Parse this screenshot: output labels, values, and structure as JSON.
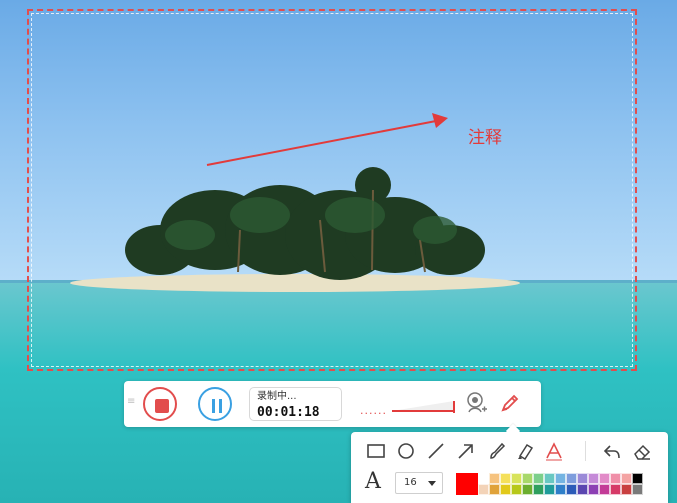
{
  "overlay": {
    "annotation_text": "注释"
  },
  "toolbar": {
    "drag_handle": "≡",
    "status_text": "录制中...",
    "timer": "00:01:18",
    "volume_dots": "......",
    "colors": {
      "stop": "#e24d4d",
      "pause": "#3aa0e2"
    }
  },
  "drawing_panel": {
    "tools": [
      {
        "name": "rectangle-tool",
        "icon": "rectangle-icon"
      },
      {
        "name": "ellipse-tool",
        "icon": "circle-icon"
      },
      {
        "name": "line-tool",
        "icon": "line-icon"
      },
      {
        "name": "arrow-tool",
        "icon": "arrow-icon"
      },
      {
        "name": "brush-tool",
        "icon": "brush-icon"
      },
      {
        "name": "highlighter-tool",
        "icon": "highlighter-icon"
      },
      {
        "name": "text-tool",
        "icon": "text-a-icon"
      },
      {
        "name": "undo-tool",
        "icon": "undo-icon"
      },
      {
        "name": "eraser-tool",
        "icon": "eraser-icon"
      }
    ],
    "font_glyph": "A",
    "font_size": "16",
    "current_color": "#ff0000",
    "palette_row1": [
      "#ffffff",
      "#f6c37f",
      "#f5e05a",
      "#d8e35a",
      "#a8d86a",
      "#7ccf8b",
      "#69c8c2",
      "#74b4e2",
      "#7e9ddd",
      "#9b8ad8",
      "#c58ad8",
      "#e28bc8",
      "#f08fa8",
      "#f4a3a3",
      "#000000"
    ],
    "palette_row2": [
      "#f3d3b8",
      "#e0a23a",
      "#e2c91a",
      "#b7c81a",
      "#6cae2f",
      "#2f9f5e",
      "#1f9c9a",
      "#2f7fc9",
      "#2c5bb8",
      "#5b46b0",
      "#8d3fb4",
      "#c33b97",
      "#d63a67",
      "#c94040",
      "#7a7a7a"
    ]
  }
}
